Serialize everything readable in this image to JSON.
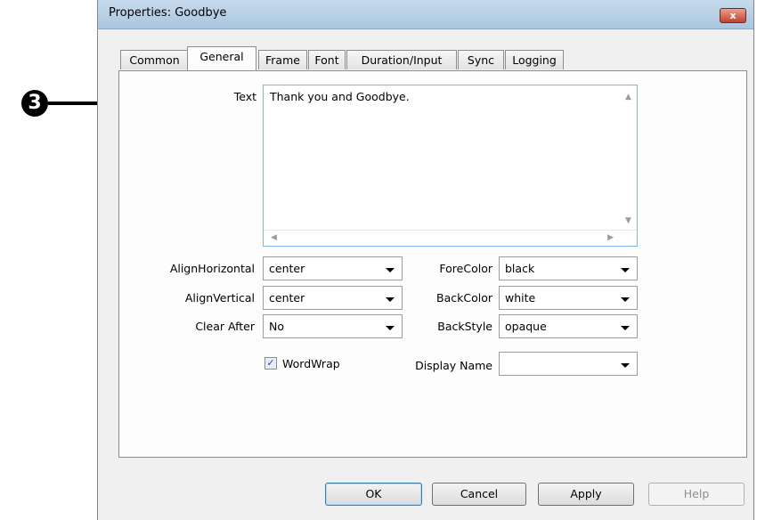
{
  "annotation": {
    "number": "3"
  },
  "window": {
    "title": "Properties: Goodbye",
    "close_label": "x"
  },
  "tabs": [
    {
      "label": "Common"
    },
    {
      "label": "General"
    },
    {
      "label": "Frame"
    },
    {
      "label": "Font"
    },
    {
      "label": "Duration/Input"
    },
    {
      "label": "Sync"
    },
    {
      "label": "Logging"
    }
  ],
  "active_tab": "General",
  "fields": {
    "text_label": "Text",
    "text_value": "Thank you and Goodbye.",
    "align_horizontal": {
      "label": "AlignHorizontal",
      "value": "center"
    },
    "align_vertical": {
      "label": "AlignVertical",
      "value": "center"
    },
    "clear_after": {
      "label": "Clear After",
      "value": "No"
    },
    "fore_color": {
      "label": "ForeColor",
      "value": "black"
    },
    "back_color": {
      "label": "BackColor",
      "value": "white"
    },
    "back_style": {
      "label": "BackStyle",
      "value": "opaque"
    },
    "wordwrap": {
      "label": "WordWrap",
      "checked": true,
      "check_glyph": "✓"
    },
    "display_name": {
      "label": "Display Name",
      "value": ""
    }
  },
  "buttons": {
    "ok": "OK",
    "cancel": "Cancel",
    "apply": "Apply",
    "help": "Help"
  },
  "colors": {
    "title_bar": "#b9d1ea",
    "close_button": "#c4412f",
    "text_focus_border": "#7eb4ea"
  }
}
